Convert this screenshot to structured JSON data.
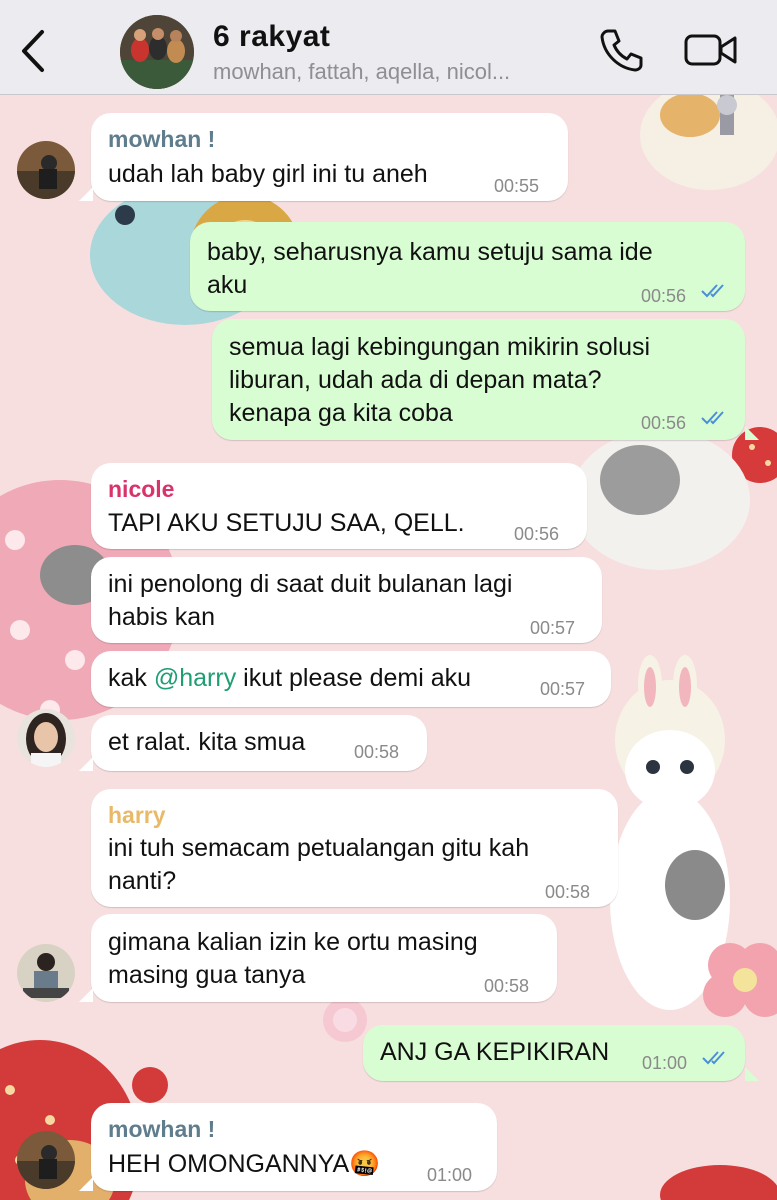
{
  "header": {
    "back_label": "back",
    "title": "6 rakyat",
    "members": "mowhan, fattah, aqella, nicol..."
  },
  "colors": {
    "sender_mowhan": "#5f7d8c",
    "sender_nicole": "#d8336a",
    "sender_harry": "#e9b96a",
    "mention": "#1f9d75",
    "read_ticks": "#4a90d9",
    "outgoing_bubble": "#d9fdd3",
    "incoming_bubble": "#ffffff"
  },
  "messages": [
    {
      "sender": "mowhan !",
      "text": "udah lah baby girl ini tu aneh",
      "time": "00:55"
    },
    {
      "text_line1": "baby, seharusnya kamu setuju sama ide",
      "text_line2": "aku",
      "time": "00:56"
    },
    {
      "text_line1": "semua lagi kebingungan mikirin solusi",
      "text_line2": "liburan, udah ada di depan mata?",
      "text_line3": "kenapa ga kita coba",
      "time": "00:56"
    },
    {
      "sender": "nicole",
      "text": "TAPI AKU SETUJU SAA, QELL.",
      "time": "00:56"
    },
    {
      "text_line1": "ini penolong di saat duit bulanan lagi",
      "text_line2": "habis kan",
      "time": "00:57"
    },
    {
      "text_before": "kak ",
      "mention": "@harry",
      "text_after": " ikut please demi aku",
      "time": "00:57"
    },
    {
      "text": "et ralat. kita smua",
      "time": "00:58"
    },
    {
      "sender": "harry",
      "text_line1": "ini tuh semacam petualangan gitu kah",
      "text_line2": "nanti?",
      "time": "00:58"
    },
    {
      "text_line1": "gimana kalian izin ke ortu masing",
      "text_line2": "masing gua tanya",
      "time": "00:58"
    },
    {
      "text": "ANJ GA KEPIKIRAN",
      "time": "01:00"
    },
    {
      "sender": "mowhan !",
      "text": "HEH OMONGANNYA🤬",
      "time": "01:00"
    }
  ],
  "icons": {
    "back": "chevron-left-icon",
    "call": "phone-icon",
    "video": "video-camera-icon",
    "read": "double-check-icon"
  }
}
